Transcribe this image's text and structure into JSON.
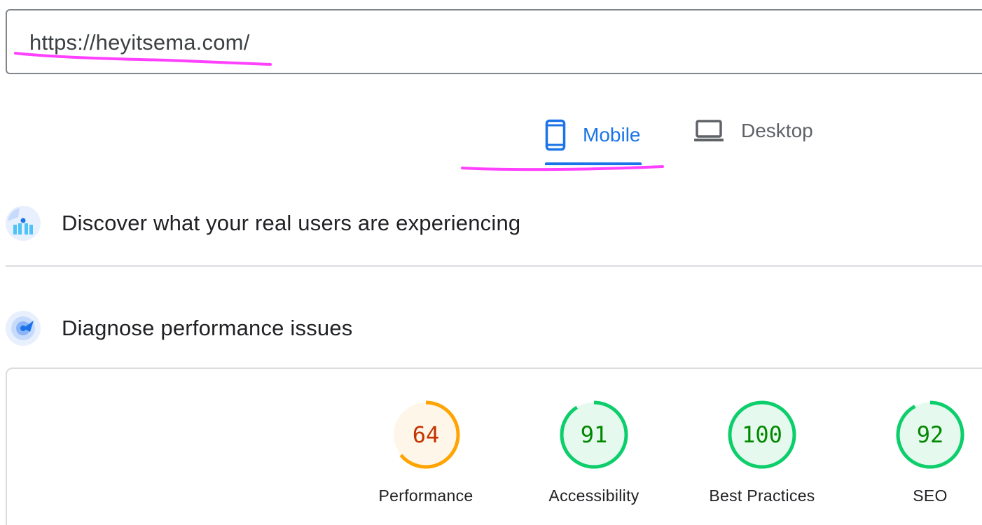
{
  "url_input": {
    "value": "https://heyitsema.com/"
  },
  "tabs": [
    {
      "label": "Mobile",
      "icon": "phone-icon",
      "active": true
    },
    {
      "label": "Desktop",
      "icon": "laptop-icon",
      "active": false
    }
  ],
  "sections": {
    "field_data": {
      "title": "Discover what your real users are experiencing",
      "icon": "users-chart-icon"
    },
    "lab_data": {
      "title": "Diagnose performance issues",
      "icon": "radar-icon"
    }
  },
  "scores": [
    {
      "label": "Performance",
      "value": "64",
      "fraction": 0.64,
      "status": "average"
    },
    {
      "label": "Accessibility",
      "value": "91",
      "fraction": 0.91,
      "status": "pass"
    },
    {
      "label": "Best Practices",
      "value": "100",
      "fraction": 1.0,
      "status": "pass"
    },
    {
      "label": "SEO",
      "value": "92",
      "fraction": 0.92,
      "status": "pass"
    }
  ],
  "colors": {
    "accent": "#1a73e8",
    "annotation": "#ff40ff",
    "pass_stroke": "#0cce6b",
    "pass_fill": "#e6f9ee",
    "pass_text": "#008800",
    "average_stroke": "#ffa400",
    "average_fill": "#fff6ea",
    "average_text": "#c33300"
  }
}
